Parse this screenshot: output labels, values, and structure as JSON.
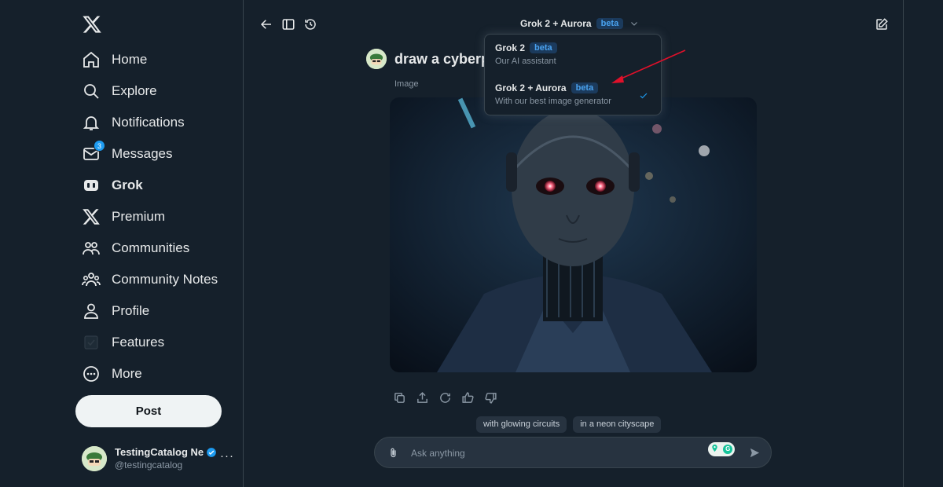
{
  "sidebar": {
    "nav": [
      {
        "label": "Home",
        "icon": "home-icon"
      },
      {
        "label": "Explore",
        "icon": "search-icon"
      },
      {
        "label": "Notifications",
        "icon": "bell-icon"
      },
      {
        "label": "Messages",
        "icon": "mail-icon",
        "badge": "3"
      },
      {
        "label": "Grok",
        "icon": "grok-icon",
        "active": true
      },
      {
        "label": "Premium",
        "icon": "x-logo-icon"
      },
      {
        "label": "Communities",
        "icon": "communities-icon"
      },
      {
        "label": "Community Notes",
        "icon": "community-notes-icon"
      },
      {
        "label": "Profile",
        "icon": "person-icon"
      },
      {
        "label": "Features",
        "icon": "features-icon"
      },
      {
        "label": "More",
        "icon": "more-circle-icon"
      }
    ],
    "post_label": "Post",
    "account": {
      "name": "TestingCatalog Ne",
      "handle": "@testingcatalog",
      "more": "···"
    }
  },
  "header": {
    "model_name": "Grok 2 + Aurora",
    "model_badge": "beta"
  },
  "dropdown": {
    "options": [
      {
        "title": "Grok 2",
        "badge": "beta",
        "subtitle": "Our AI assistant",
        "selected": false
      },
      {
        "title": "Grok 2 + Aurora",
        "badge": "beta",
        "subtitle": "With our best image generator",
        "selected": true
      }
    ]
  },
  "conversation": {
    "prompt": "draw a cyberp",
    "image_label": "Image"
  },
  "suggestions": [
    "with glowing circuits",
    "in a neon cityscape"
  ],
  "composer": {
    "placeholder": "Ask anything"
  },
  "colors": {
    "background": "#15202b",
    "accent": "#1d9bf0",
    "annotation_arrow": "#e0102a"
  }
}
